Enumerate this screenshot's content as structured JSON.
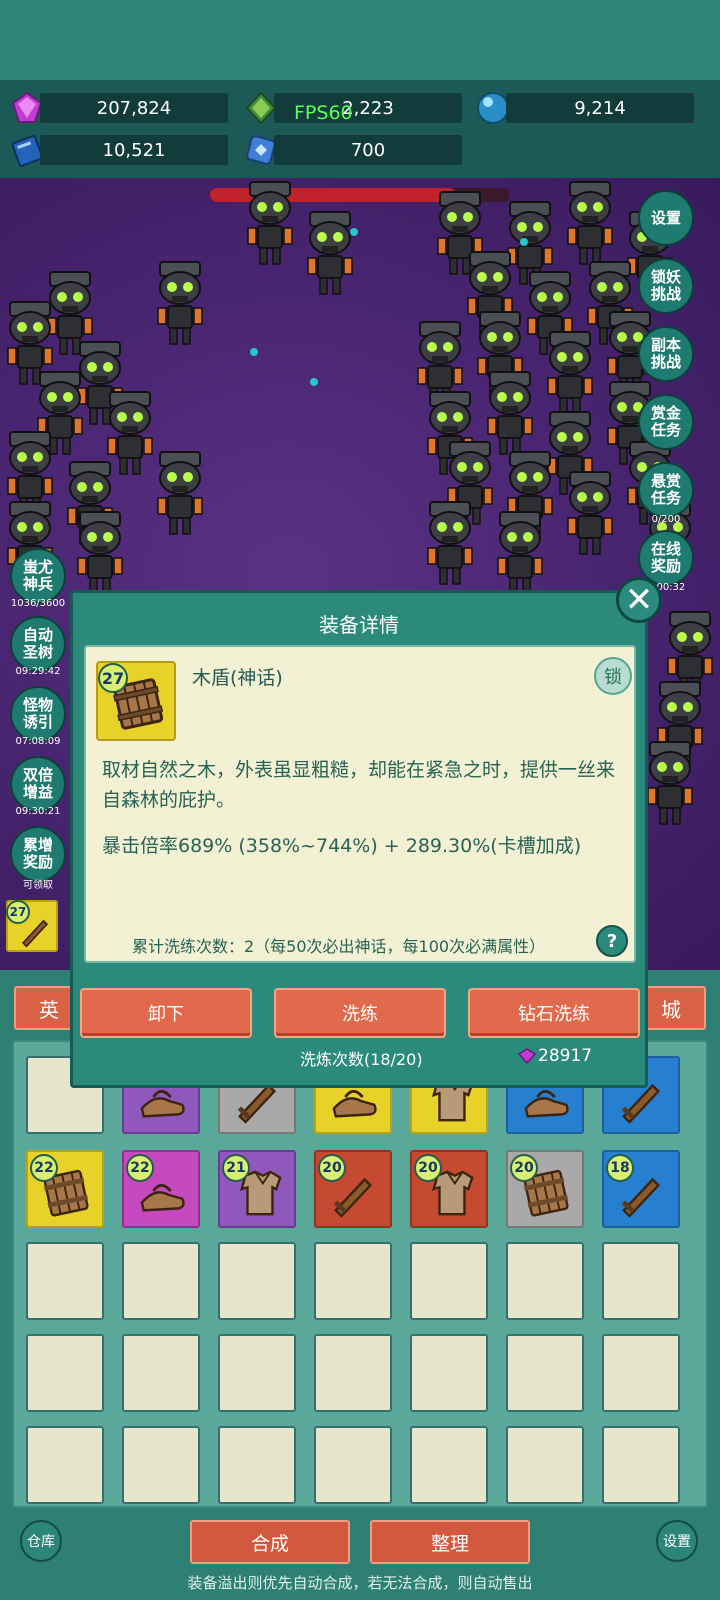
{
  "resources": {
    "gems": "207,824",
    "green_gem": "2,223",
    "orb": "9,214",
    "book": "10,521",
    "scroll": "700",
    "fps": "FPS60"
  },
  "boss_hp_fraction": 0.82,
  "side_buttons": [
    {
      "label": "设置"
    },
    {
      "label": "锁妖\n挑战"
    },
    {
      "label": "副本\n挑战"
    },
    {
      "label": "赏金\n任务"
    },
    {
      "label": "悬赏\n任务",
      "sub": "0/200"
    },
    {
      "label": "在线\n奖励",
      "sub": "0:00:32"
    }
  ],
  "left_buttons": [
    {
      "label": "蚩尤\n神兵",
      "sub": "1036/3600"
    },
    {
      "label": "自动\n圣树",
      "sub": "09:29:42"
    },
    {
      "label": "怪物\n诱引",
      "sub": "07:08:09"
    },
    {
      "label": "双倍\n增益",
      "sub": "09:30:21"
    },
    {
      "label": "累增\n奖励",
      "sub": "可领取"
    }
  ],
  "dialog": {
    "title": "装备详情",
    "item_level": "27",
    "item_name": "木盾(神话)",
    "lock_label": "锁",
    "description": "取材自然之木，外表虽显粗糙，却能在紧急之时，提供一丝来自森林的庇护。",
    "stat": "暴击倍率689% (358%~744%) + 289.30%(卡槽加成)",
    "refine_info": "累计洗练次数：2（每50次必出神话，每100次必满属性）",
    "help_label": "?",
    "close_label": "✕",
    "buttons": {
      "unequip": "卸下",
      "refine": "洗练",
      "diamond_refine": "钻石洗练"
    },
    "refine_count": "洗炼次数(18/20)",
    "diamond_cost": "28917"
  },
  "equipped_left_level": "27",
  "tabs": {
    "left": "英",
    "right": "城"
  },
  "inventory_rows": [
    [
      {
        "color": "empty"
      },
      {
        "color": "purple",
        "icon": "sandal"
      },
      {
        "color": "gray",
        "icon": "sword"
      },
      {
        "color": "yellow",
        "icon": "sandal"
      },
      {
        "color": "yellow",
        "icon": "shirt"
      },
      {
        "color": "blue",
        "icon": "sandal"
      },
      {
        "color": "blue",
        "icon": "sword"
      }
    ],
    [
      {
        "color": "yellow",
        "icon": "shield",
        "level": "22"
      },
      {
        "color": "magenta",
        "icon": "sandal",
        "level": "22"
      },
      {
        "color": "purple",
        "icon": "shirt",
        "level": "21"
      },
      {
        "color": "red",
        "icon": "sword",
        "level": "20"
      },
      {
        "color": "red",
        "icon": "shirt",
        "level": "20"
      },
      {
        "color": "gray",
        "icon": "shield",
        "level": "20"
      },
      {
        "color": "blue",
        "icon": "sword",
        "level": "18"
      }
    ]
  ],
  "bottom": {
    "warehouse": "仓库",
    "merge": "合成",
    "sort": "整理",
    "settings": "设置",
    "footer": "装备溢出则优先自动合成，若无法合成，则自动售出"
  }
}
